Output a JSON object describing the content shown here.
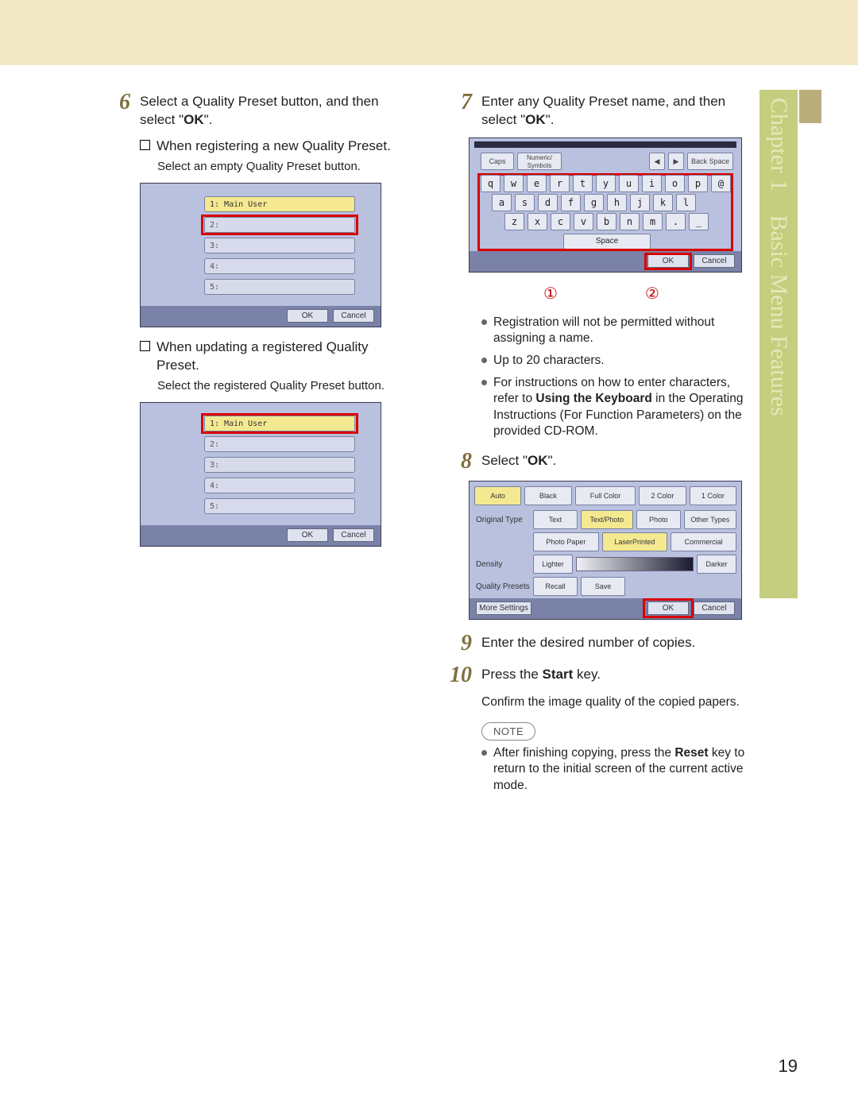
{
  "header": {
    "chapter": "Chapter 1",
    "title": "Basic Menu Features"
  },
  "page_number": "19",
  "steps": {
    "s6": {
      "num": "6",
      "text_a": "Select a Quality Preset button, and then select \"",
      "ok": "OK",
      "text_b": "\".",
      "sub1_label": "When registering a new Quality Preset.",
      "sub1_note": "Select an empty Quality Preset button.",
      "sub2_label": "When updating a registered Quality Preset.",
      "sub2_note": "Select the registered Quality Preset button."
    },
    "s7": {
      "num": "7",
      "text_a": "Enter any Quality Preset name, and then select \"",
      "ok": "OK",
      "text_b": "\".",
      "bullets": {
        "b1": "Registration will not be permitted without assigning a name.",
        "b2": "Up to 20 characters.",
        "b3_a": "For instructions on how to enter characters, refer to ",
        "b3_bold": "Using the Keyboard",
        "b3_b": " in the Operating Instructions (For Function Parameters) on the provided CD-ROM."
      },
      "callouts": {
        "c1": "①",
        "c2": "②"
      }
    },
    "s8": {
      "num": "8",
      "text_a": "Select \"",
      "ok": "OK",
      "text_b": "\"."
    },
    "s9": {
      "num": "9",
      "text": "Enter the desired number of copies."
    },
    "s10": {
      "num": "10",
      "text_a": "Press the ",
      "bold": "Start",
      "text_b": " key.",
      "sub": "Confirm the image quality of the copied papers.",
      "note_badge": "NOTE",
      "note_a": "After finishing copying, press the ",
      "note_bold": "Reset",
      "note_b": " key to return to the initial screen of the current active mode."
    }
  },
  "mock_preset": {
    "row1": "1: Main User",
    "row2": "2:",
    "row3": "3:",
    "row4": "4:",
    "row5": "5:",
    "ok": "OK",
    "cancel": "Cancel"
  },
  "mock_kb": {
    "caps": "Caps",
    "numsym": "Numeric/\nSymbols",
    "back": "Back Space",
    "row1": [
      "q",
      "w",
      "e",
      "r",
      "t",
      "y",
      "u",
      "i",
      "o",
      "p",
      "@"
    ],
    "row2": [
      "a",
      "s",
      "d",
      "f",
      "g",
      "h",
      "j",
      "k",
      "l"
    ],
    "row3": [
      "z",
      "x",
      "c",
      "v",
      "b",
      "n",
      "m",
      ".",
      "_"
    ],
    "space": "Space",
    "ok": "OK",
    "cancel": "Cancel"
  },
  "mock_settings": {
    "top": {
      "auto": "Auto",
      "black": "Black",
      "full": "Full Color",
      "two": "2 Color",
      "one": "1 Color"
    },
    "orig_label": "Original Type",
    "orig": {
      "text": "Text",
      "textphoto": "Text/Photo",
      "photo": "Photo",
      "other": "Other Types"
    },
    "paper": {
      "photo": "Photo Paper",
      "laser": "LaserPrinted",
      "comm": "Commercial"
    },
    "density_label": "Density",
    "density": {
      "lighter": "Lighter",
      "darker": "Darker"
    },
    "qp_label": "Quality Presets",
    "qp": {
      "recall": "Recall",
      "save": "Save"
    },
    "more": "More Settings",
    "ok": "OK",
    "cancel": "Cancel"
  }
}
